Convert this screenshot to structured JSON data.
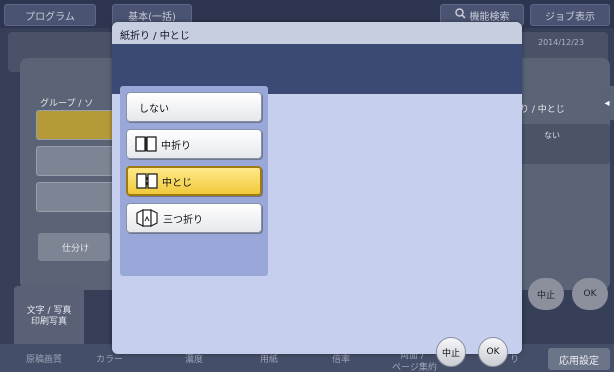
{
  "topbar": {
    "program_label": "プログラム",
    "basic_label": "基本(一括)",
    "search_label": "機能検索",
    "job_display_label": "ジョブ表示"
  },
  "background": {
    "date": "2014/12/23",
    "group_sort_label": "グループ / ソ",
    "sort_label": "仕分け",
    "right_label": "り / 中とじ",
    "right_value": "ない",
    "mode_label_line1": "文字 / 写真",
    "mode_label_line2": "印刷写真",
    "stop_label": "中止",
    "ok_label": "OK",
    "apply_label": "応用設定",
    "bottom_tabs": [
      "原稿画質",
      "カラー",
      "濃度",
      "用紙",
      "倍率",
      "両面 /",
      "ページ集約",
      "り"
    ]
  },
  "dialog": {
    "title": "紙折り / 中とじ",
    "options": [
      {
        "label": "しない",
        "icon": "none",
        "selected": false
      },
      {
        "label": "中折り",
        "icon": "half-fold-icon",
        "selected": false
      },
      {
        "label": "中とじ",
        "icon": "saddle-stitch-icon",
        "selected": true
      },
      {
        "label": "三つ折り",
        "icon": "tri-fold-icon",
        "selected": false
      }
    ],
    "stop_label": "中止",
    "ok_label": "OK"
  },
  "colors": {
    "dialog_band": "#3a4a75",
    "dialog_body": "#c6d0ee",
    "option_panel": "#9aa8d9",
    "selected_option": "#f2c93b"
  }
}
